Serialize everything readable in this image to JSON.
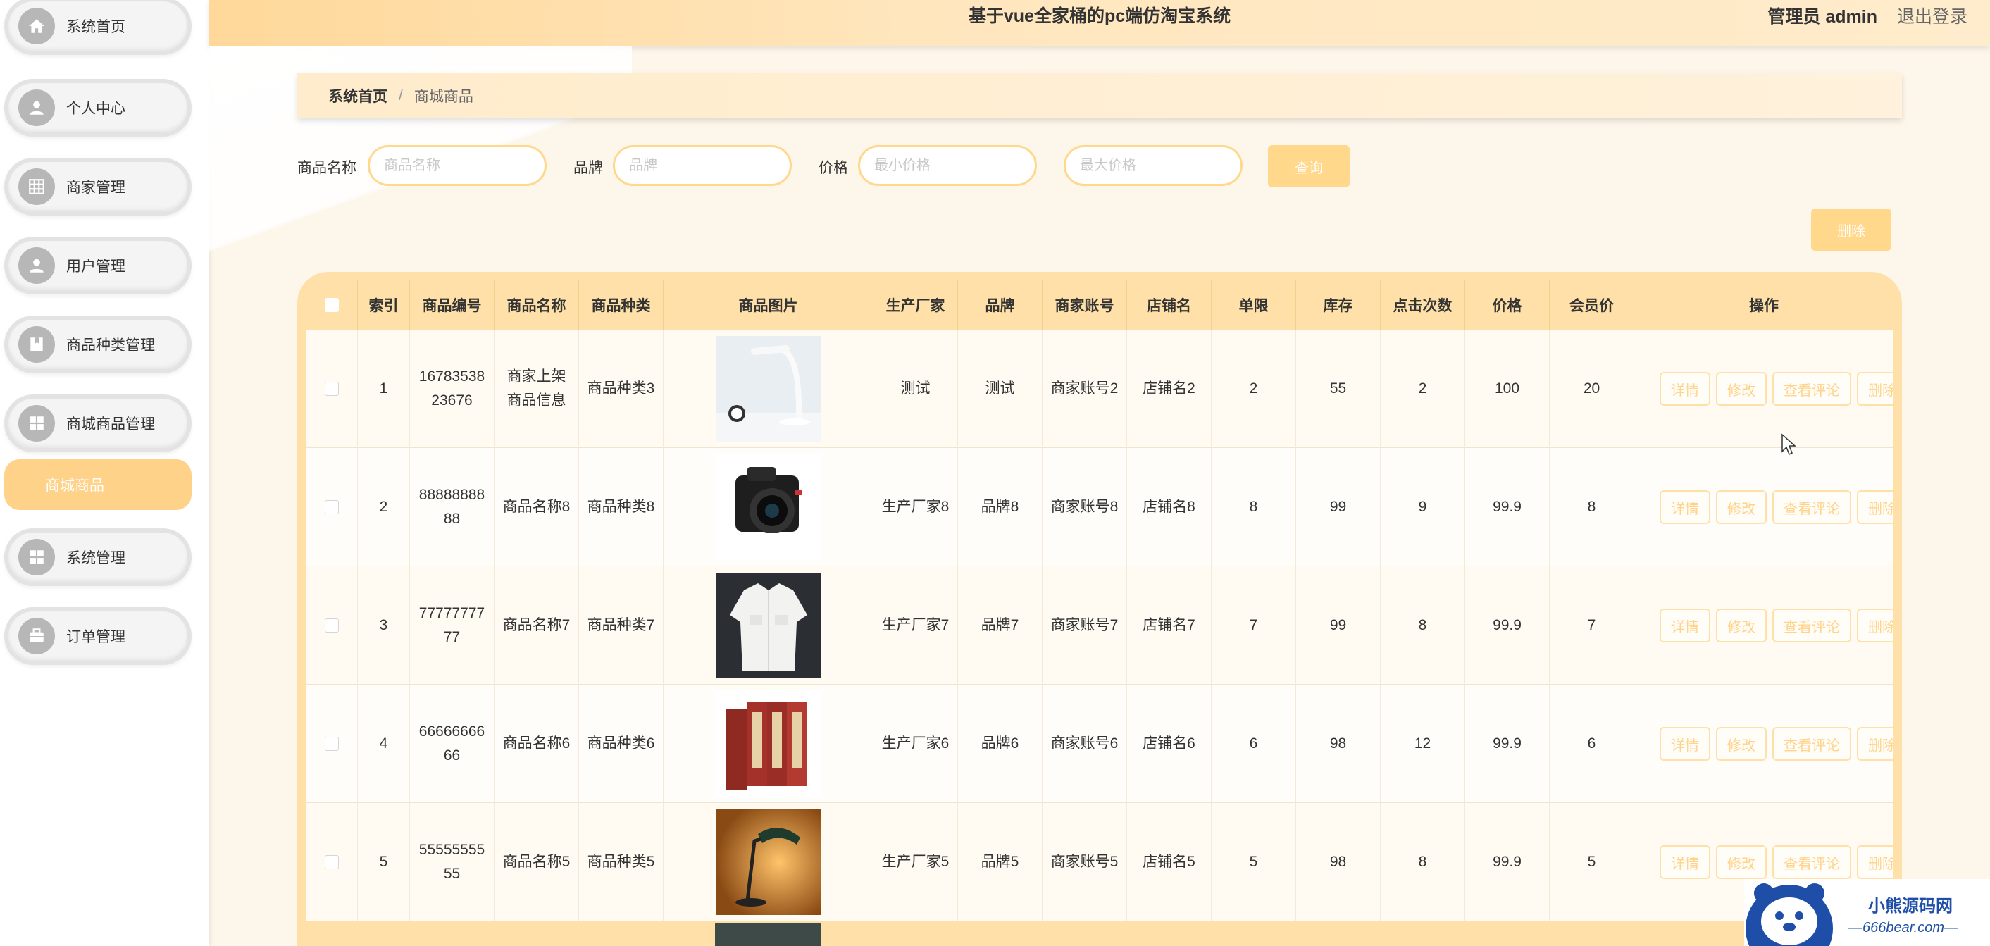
{
  "header": {
    "title": "基于vue全家桶的pc端仿淘宝系统",
    "user": "管理员 admin",
    "logout": "退出登录"
  },
  "sidebar": {
    "items": [
      {
        "label": "系统首页",
        "icon": "home-icon"
      },
      {
        "label": "个人中心",
        "icon": "user-icon"
      },
      {
        "label": "商家管理",
        "icon": "grid-icon"
      },
      {
        "label": "用户管理",
        "icon": "user-icon"
      },
      {
        "label": "商品种类管理",
        "icon": "bookmark-icon"
      },
      {
        "label": "商城商品管理",
        "icon": "apps-icon"
      },
      {
        "label": "系统管理",
        "icon": "apps-icon"
      },
      {
        "label": "订单管理",
        "icon": "briefcase-icon"
      }
    ],
    "active_sub": "商城商品"
  },
  "breadcrumb": {
    "home": "系统首页",
    "separator": "/",
    "current": "商城商品"
  },
  "search": {
    "name_label": "商品名称",
    "name_placeholder": "商品名称",
    "brand_label": "品牌",
    "brand_placeholder": "品牌",
    "price_label": "价格",
    "min_placeholder": "最小价格",
    "max_placeholder": "最大价格",
    "query_button": "查询"
  },
  "actions": {
    "delete_button": "删除"
  },
  "table": {
    "columns": [
      "索引",
      "商品编号",
      "商品名称",
      "商品种类",
      "商品图片",
      "生产厂家",
      "品牌",
      "商家账号",
      "店铺名",
      "单限",
      "库存",
      "点击次数",
      "价格",
      "会员价",
      "操作"
    ],
    "ops": [
      "详情",
      "修改",
      "查看评论",
      "删除"
    ],
    "rows": [
      {
        "index": "1",
        "code": "1678353823676",
        "name": "商家上架商品信息",
        "category": "商品种类3",
        "image": "desk-lamp-image",
        "maker": "测试",
        "brand": "测试",
        "merchant": "商家账号2",
        "shop": "店铺名2",
        "limit": "2",
        "stock": "55",
        "clicks": "2",
        "price": "100",
        "member_price": "20"
      },
      {
        "index": "2",
        "code": "8888888888",
        "name": "商品名称8",
        "category": "商品种类8",
        "image": "camera-image",
        "maker": "生产厂家8",
        "brand": "品牌8",
        "merchant": "商家账号8",
        "shop": "店铺名8",
        "limit": "8",
        "stock": "99",
        "clicks": "9",
        "price": "99.9",
        "member_price": "8"
      },
      {
        "index": "3",
        "code": "7777777777",
        "name": "商品名称7",
        "category": "商品种类7",
        "image": "jacket-image",
        "maker": "生产厂家7",
        "brand": "品牌7",
        "merchant": "商家账号7",
        "shop": "店铺名7",
        "limit": "7",
        "stock": "99",
        "clicks": "8",
        "price": "99.9",
        "member_price": "7"
      },
      {
        "index": "4",
        "code": "6666666666",
        "name": "商品名称6",
        "category": "商品种类6",
        "image": "books-image",
        "maker": "生产厂家6",
        "brand": "品牌6",
        "merchant": "商家账号6",
        "shop": "店铺名6",
        "limit": "6",
        "stock": "98",
        "clicks": "12",
        "price": "99.9",
        "member_price": "6"
      },
      {
        "index": "5",
        "code": "5555555555",
        "name": "商品名称5",
        "category": "商品种类5",
        "image": "table-lamp-image",
        "maker": "生产厂家5",
        "brand": "品牌5",
        "merchant": "商家账号5",
        "shop": "店铺名5",
        "limit": "5",
        "stock": "98",
        "clicks": "8",
        "price": "99.9",
        "member_price": "5"
      }
    ]
  },
  "watermark": {
    "line1": "小熊源码网",
    "line2": "—666bear.com—"
  }
}
